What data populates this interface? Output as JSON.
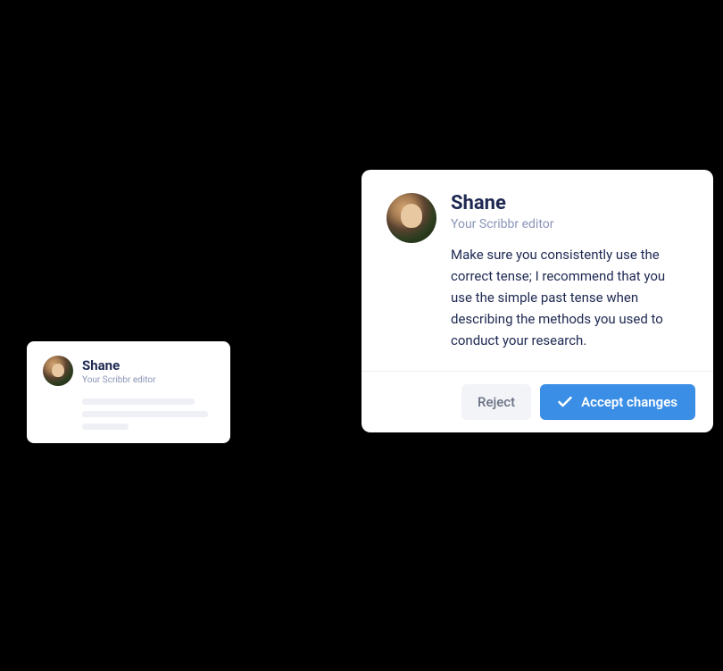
{
  "editor": {
    "name": "Shane",
    "role": "Your Scribbr editor"
  },
  "comment": {
    "message": "Make sure you consistently use the correct tense; I recommend that you use the simple past tense when describing the methods you used to conduct your research."
  },
  "actions": {
    "reject_label": "Reject",
    "accept_label": "Accept changes"
  }
}
